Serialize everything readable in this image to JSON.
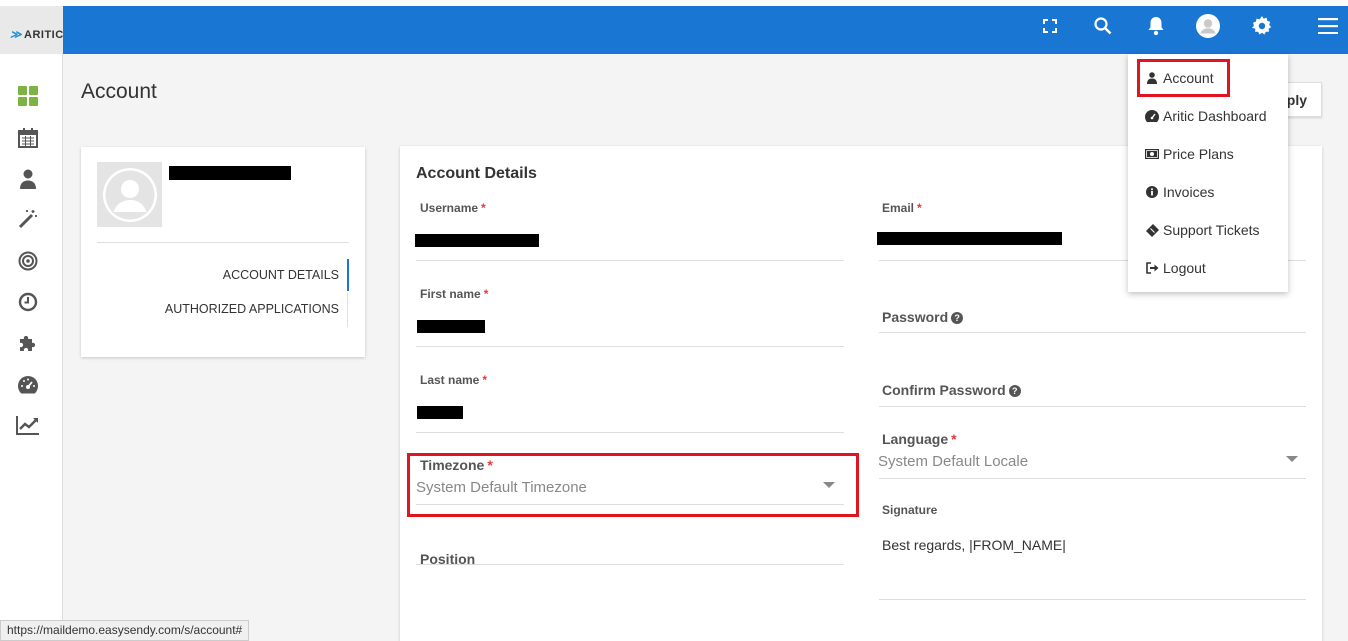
{
  "brand": {
    "name": "ARITIC"
  },
  "page": {
    "title": "Account",
    "apply_label": "pply"
  },
  "left_nav": {
    "tabs": [
      {
        "label": "ACCOUNT DETAILS"
      },
      {
        "label": "AUTHORIZED APPLICATIONS"
      }
    ]
  },
  "form": {
    "heading": "Account Details",
    "username_label": "Username",
    "email_label": "Email",
    "firstname_label": "First name",
    "password_label": "Password",
    "lastname_label": "Last name",
    "confirm_label": "Confirm Password",
    "timezone_label": "Timezone",
    "timezone_value": "System Default Timezone",
    "language_label": "Language",
    "language_value": "System Default Locale",
    "position_label": "Position",
    "signature_label": "Signature",
    "signature_value": "Best regards, |FROM_NAME|",
    "required_mark": "*"
  },
  "user_menu": {
    "items": [
      {
        "label": "Account",
        "icon": "user-icon"
      },
      {
        "label": "Aritic Dashboard",
        "icon": "dashboard-icon"
      },
      {
        "label": "Price Plans",
        "icon": "money-icon"
      },
      {
        "label": "Invoices",
        "icon": "info-icon"
      },
      {
        "label": "Support Tickets",
        "icon": "ticket-icon"
      },
      {
        "label": "Logout",
        "icon": "sign-out-icon"
      }
    ]
  },
  "status_bar": {
    "url": "https://maildemo.easysendy.com/s/account#"
  },
  "colors": {
    "topbar": "#1976d2",
    "highlight": "#e0151f",
    "sidebar_icon": "#555555",
    "dashboard_icon": "#7cb342"
  }
}
